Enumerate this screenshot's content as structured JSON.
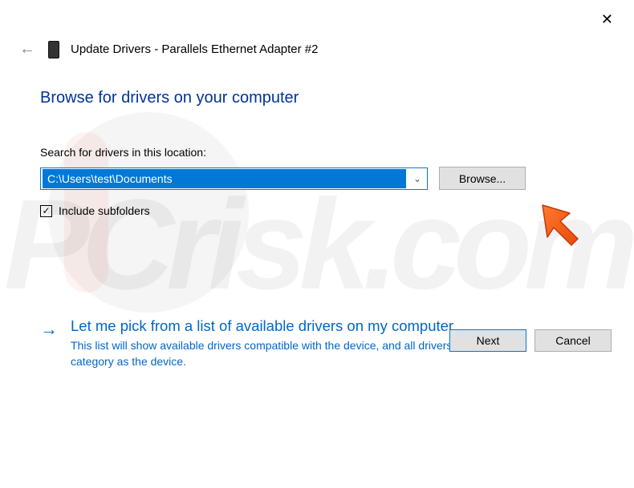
{
  "window": {
    "close_label": "✕"
  },
  "header": {
    "back_icon": "←",
    "title": "Update Drivers - Parallels Ethernet Adapter #2"
  },
  "main": {
    "page_title": "Browse for drivers on your computer",
    "search_label": "Search for drivers in this location:",
    "path_value": "C:\\Users\\test\\Documents",
    "chevron": "⌄",
    "browse_label": "Browse...",
    "include_subfolders_label": "Include subfolders",
    "checkbox_mark": "✓"
  },
  "option": {
    "arrow": "→",
    "title": "Let me pick from a list of available drivers on my computer",
    "description": "This list will show available drivers compatible with the device, and all drivers in the same category as the device."
  },
  "footer": {
    "next_label": "Next",
    "cancel_label": "Cancel"
  }
}
